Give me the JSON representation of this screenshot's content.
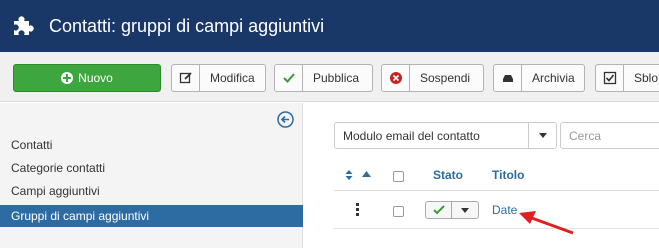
{
  "header": {
    "title": "Contatti: gruppi di campi aggiuntivi",
    "icon": "puzzle-icon"
  },
  "toolbar": {
    "new_label": "Nuovo",
    "edit_label": "Modifica",
    "publish_label": "Pubblica",
    "unpublish_label": "Sospendi",
    "archive_label": "Archivia",
    "unlock_label": "Sblo"
  },
  "sidebar": {
    "items": [
      {
        "label": "Contatti"
      },
      {
        "label": "Categorie contatti"
      },
      {
        "label": "Campi aggiuntivi"
      },
      {
        "label": "Gruppi di campi aggiuntivi",
        "active": true
      }
    ]
  },
  "filters": {
    "context_select": "Modulo email del contatto",
    "search_placeholder": "Cerca"
  },
  "table": {
    "columns": {
      "status": "Stato",
      "title": "Titolo"
    },
    "rows": [
      {
        "title": "Date"
      }
    ]
  },
  "colors": {
    "header_bg": "#1a3867",
    "new_button": "#3ea63e",
    "active_sidebar": "#2d6ca2",
    "link": "#2d6ca2",
    "annotation_arrow": "#e02020"
  }
}
